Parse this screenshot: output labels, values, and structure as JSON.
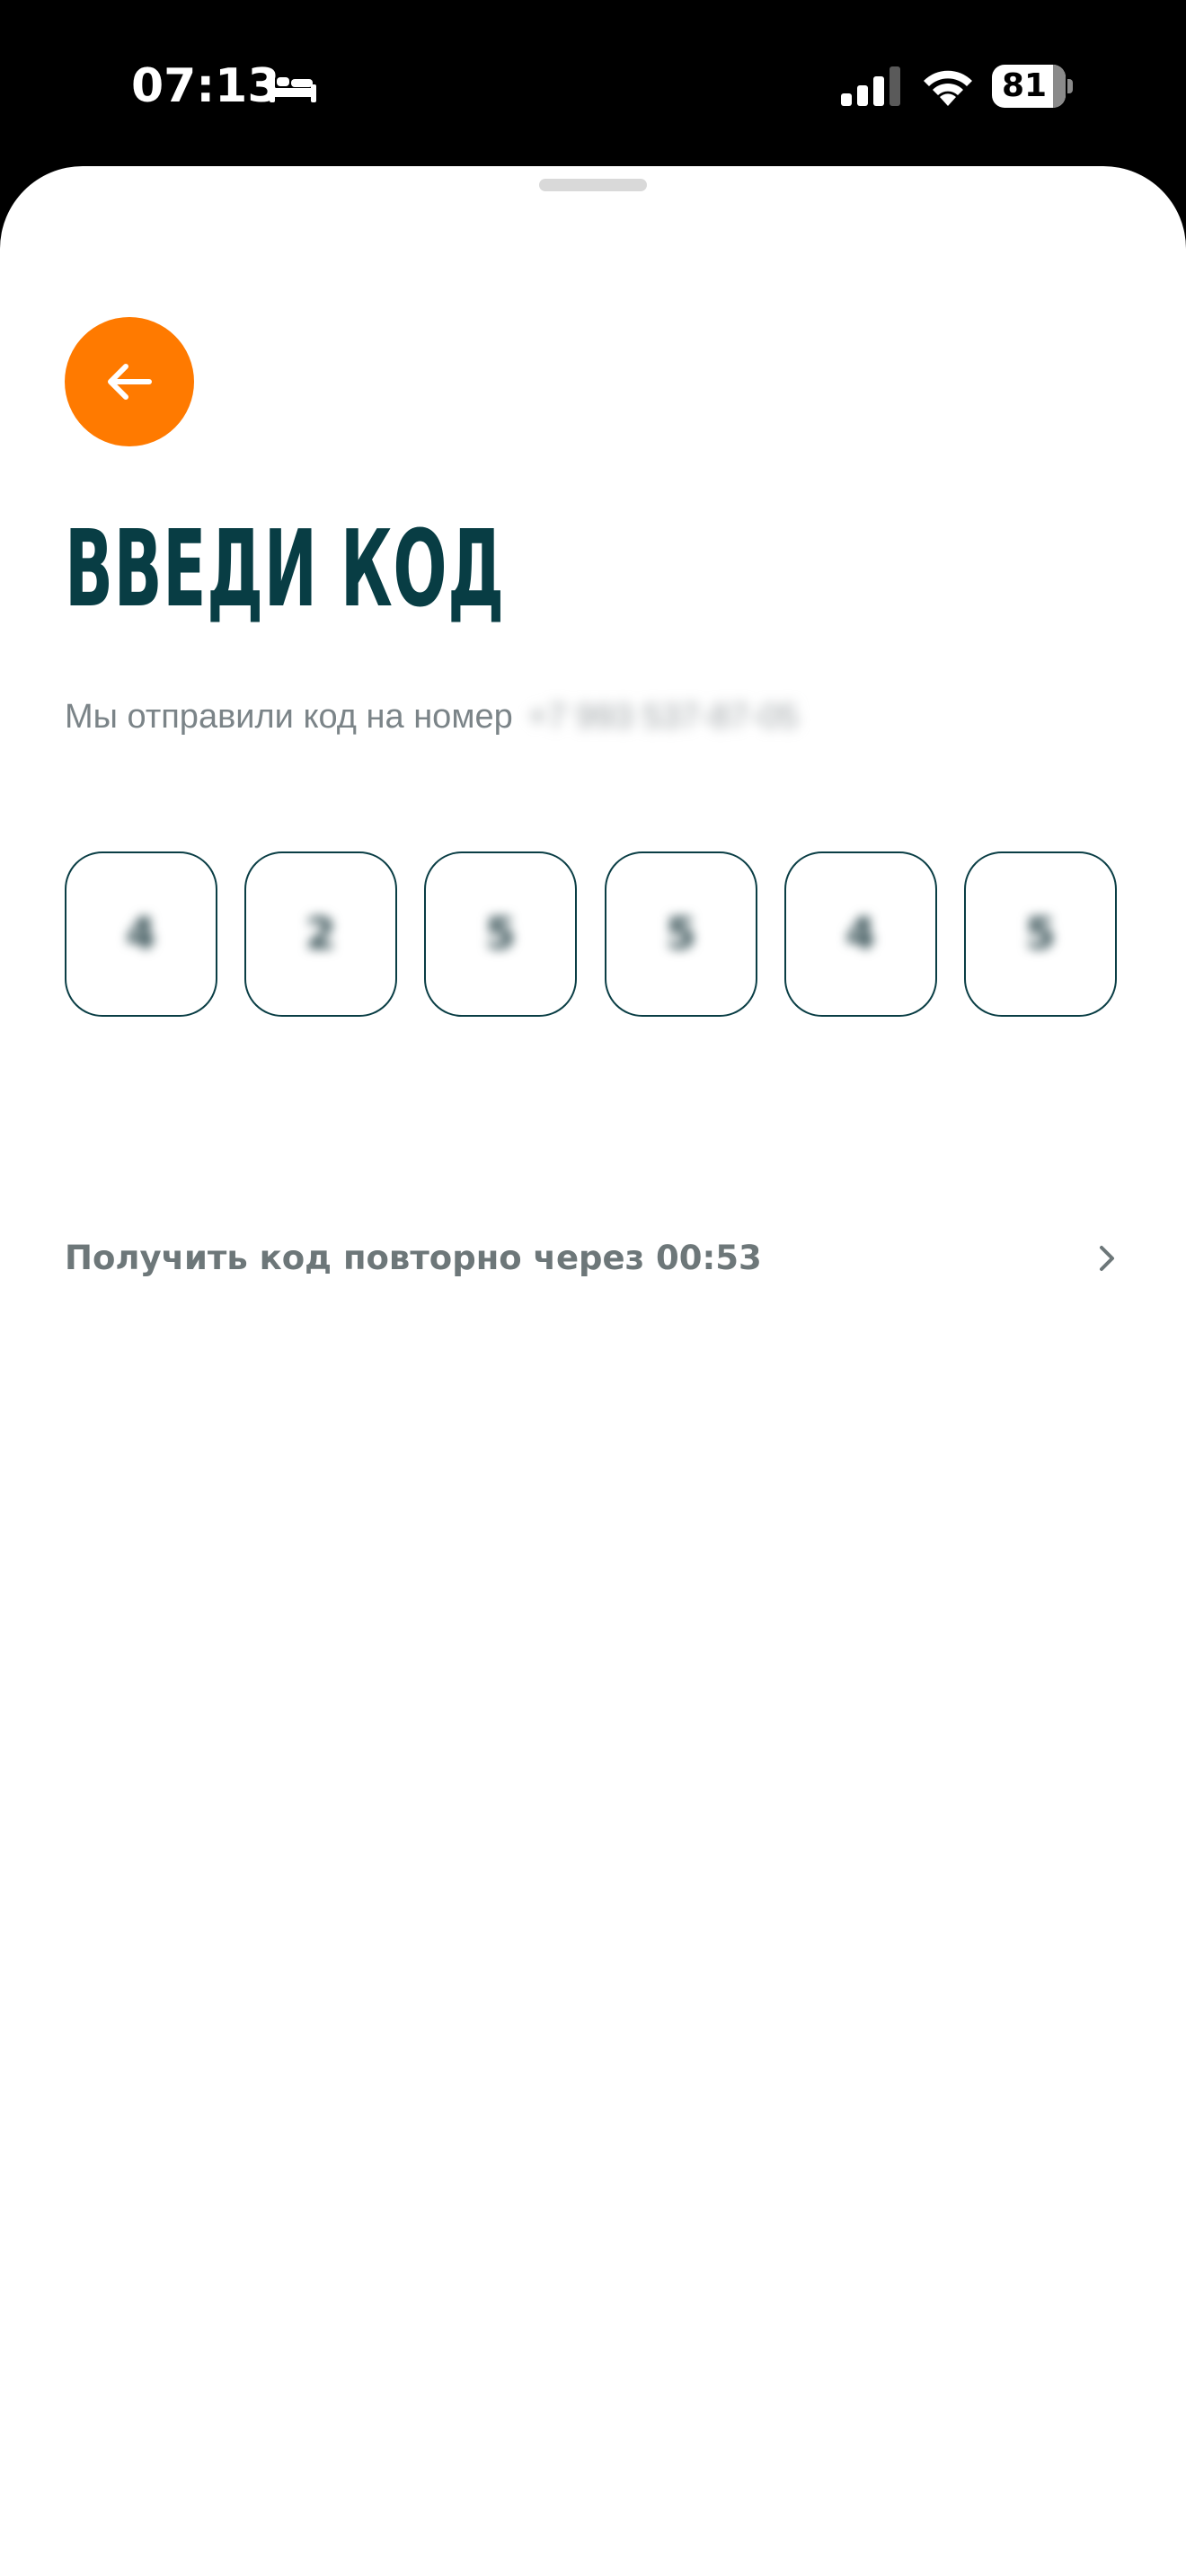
{
  "status_bar": {
    "time": "07:13",
    "battery_level": "81",
    "icons": [
      "bed-icon",
      "signal-icon",
      "wifi-icon",
      "battery-icon"
    ]
  },
  "screen": {
    "title": "ВВЕДИ КОД",
    "subtitle_prefix": "Мы отправили код на номер",
    "phone_number": "+7 993 537-87-05",
    "code_digits": [
      "4",
      "2",
      "5",
      "5",
      "4",
      "5"
    ],
    "resend_label": "Получить код повторно через 00:53",
    "back_icon": "arrow-left-icon",
    "resend_icon": "chevron-right-icon"
  },
  "colors": {
    "accent": "#ff7a00",
    "title": "#083d44",
    "cell_border": "#0a3e45",
    "muted_text": "#7b8488"
  }
}
